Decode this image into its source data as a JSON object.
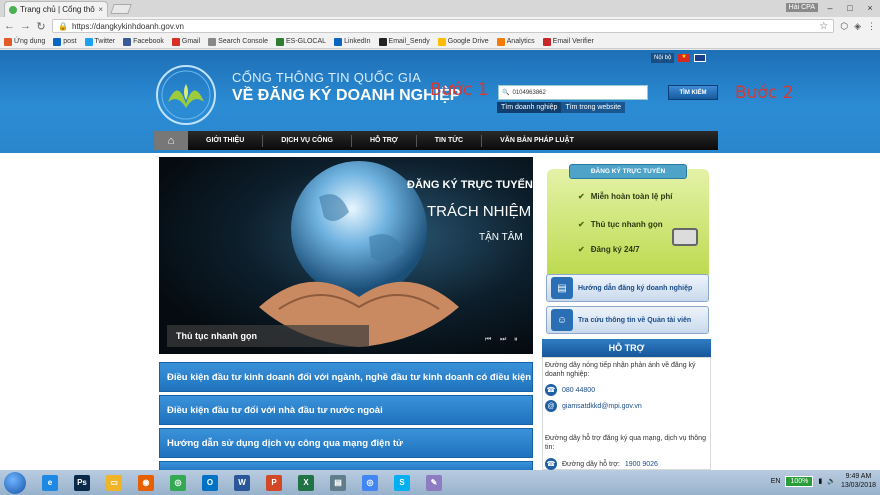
{
  "browser": {
    "tab_title": "Trang chủ | Cổng thông",
    "tab_close": "×",
    "profile": "Hải CPA",
    "url": "https://dangkykinhdoanh.gov.vn",
    "window_controls": [
      "–",
      "□",
      "×"
    ]
  },
  "bookmarks": [
    {
      "label": "Ứng dụng",
      "color": "#e05a2b"
    },
    {
      "label": "post",
      "color": "#0a66c2"
    },
    {
      "label": "Twitter",
      "color": "#1da1f2"
    },
    {
      "label": "Facebook",
      "color": "#3b5998"
    },
    {
      "label": "Gmail",
      "color": "#d93025"
    },
    {
      "label": "Search Console",
      "color": "#888888"
    },
    {
      "label": "ES-GLOCAL",
      "color": "#2e7d32"
    },
    {
      "label": "LinkedIn",
      "color": "#0a66c2"
    },
    {
      "label": "Email_Sendy",
      "color": "#222222"
    },
    {
      "label": "Google Drive",
      "color": "#fbbc04"
    },
    {
      "label": "Analytics",
      "color": "#f57c00"
    },
    {
      "label": "Email Verifier",
      "color": "#c62828"
    }
  ],
  "header": {
    "top_link": "Nội bộ",
    "brand_line1": "CỔNG THÔNG TIN QUỐC GIA",
    "brand_line2": "VỀ ĐĂNG KÝ DOANH NGHIỆP",
    "step1": "Bước 1",
    "step2": "Bước 2",
    "search_value": "0104963862",
    "search_button": "TÌM KIẾM",
    "search_tabs": [
      "Tìm doanh nghiệp",
      "Tìm trong website"
    ]
  },
  "nav": [
    "GIỚI THIỆU",
    "DỊCH VỤ CÔNG",
    "HỖ TRỢ",
    "TIN TỨC",
    "VĂN BẢN PHÁP LUẬT"
  ],
  "banner": {
    "line1": "ĐĂNG KÝ TRỰC TUYẾN",
    "line2": "TRÁCH NHIỆM",
    "line3": "TẬN TÂM",
    "caption": "Thủ tục nhanh gọn"
  },
  "bars": [
    "Điều kiện đầu tư kinh doanh đối với ngành, nghề đầu tư kinh doanh có điều kiện",
    "Điều kiện đầu tư đối với nhà đầu tư nước ngoài",
    "Hướng dẫn sử dụng dịch vụ công qua mạng điện tử"
  ],
  "online": {
    "title": "ĐĂNG KÝ TRỰC TUYẾN",
    "items": [
      "Miễn hoàn toàn lệ phí",
      "Thủ tục nhanh gọn",
      "Đăng ký 24/7"
    ]
  },
  "right_buttons": [
    "Hướng dẫn đăng ký doanh nghiệp",
    "Tra cứu thông tin về Quản tài viên"
  ],
  "support": {
    "title": "HỖ TRỢ",
    "text1": "Đường dây nóng tiếp nhận phản ánh về đăng ký doanh nghiệp:",
    "phone1": "080 44800",
    "email": "giamsatdkkd@mpi.gov.vn",
    "text2": "Đường dây hỗ trợ đăng ký qua mạng, dịch vụ thông tin:",
    "phone2_label": "Đường dây hỗ trợ:",
    "phone2": "1900 9026"
  },
  "taskbar": {
    "apps": [
      {
        "icon": "ie-icon",
        "color": "#1e88e5",
        "glyph": "e"
      },
      {
        "icon": "photoshop-icon",
        "color": "#0b2a4a",
        "glyph": "Ps"
      },
      {
        "icon": "folder-icon",
        "color": "#f0b429",
        "glyph": "▭"
      },
      {
        "icon": "firefox-icon",
        "color": "#e66000",
        "glyph": "◉"
      },
      {
        "icon": "chrome-icon",
        "color": "#34a853",
        "glyph": "◎"
      },
      {
        "icon": "outlook-icon",
        "color": "#0072c6",
        "glyph": "O"
      },
      {
        "icon": "word-icon",
        "color": "#2b579a",
        "glyph": "W"
      },
      {
        "icon": "powerpoint-icon",
        "color": "#d24726",
        "glyph": "P"
      },
      {
        "icon": "excel-icon",
        "color": "#217346",
        "glyph": "X"
      },
      {
        "icon": "fax-icon",
        "color": "#607d8b",
        "glyph": "▤"
      },
      {
        "icon": "chrome-active-icon",
        "color": "#4285f4",
        "glyph": "◎"
      },
      {
        "icon": "skype-icon",
        "color": "#00aff0",
        "glyph": "S"
      },
      {
        "icon": "paint-icon",
        "color": "#8e7cc3",
        "glyph": "✎"
      }
    ],
    "lang": "EN",
    "battery": "100%",
    "time": "9:49 AM",
    "date": "13/03/2018"
  }
}
